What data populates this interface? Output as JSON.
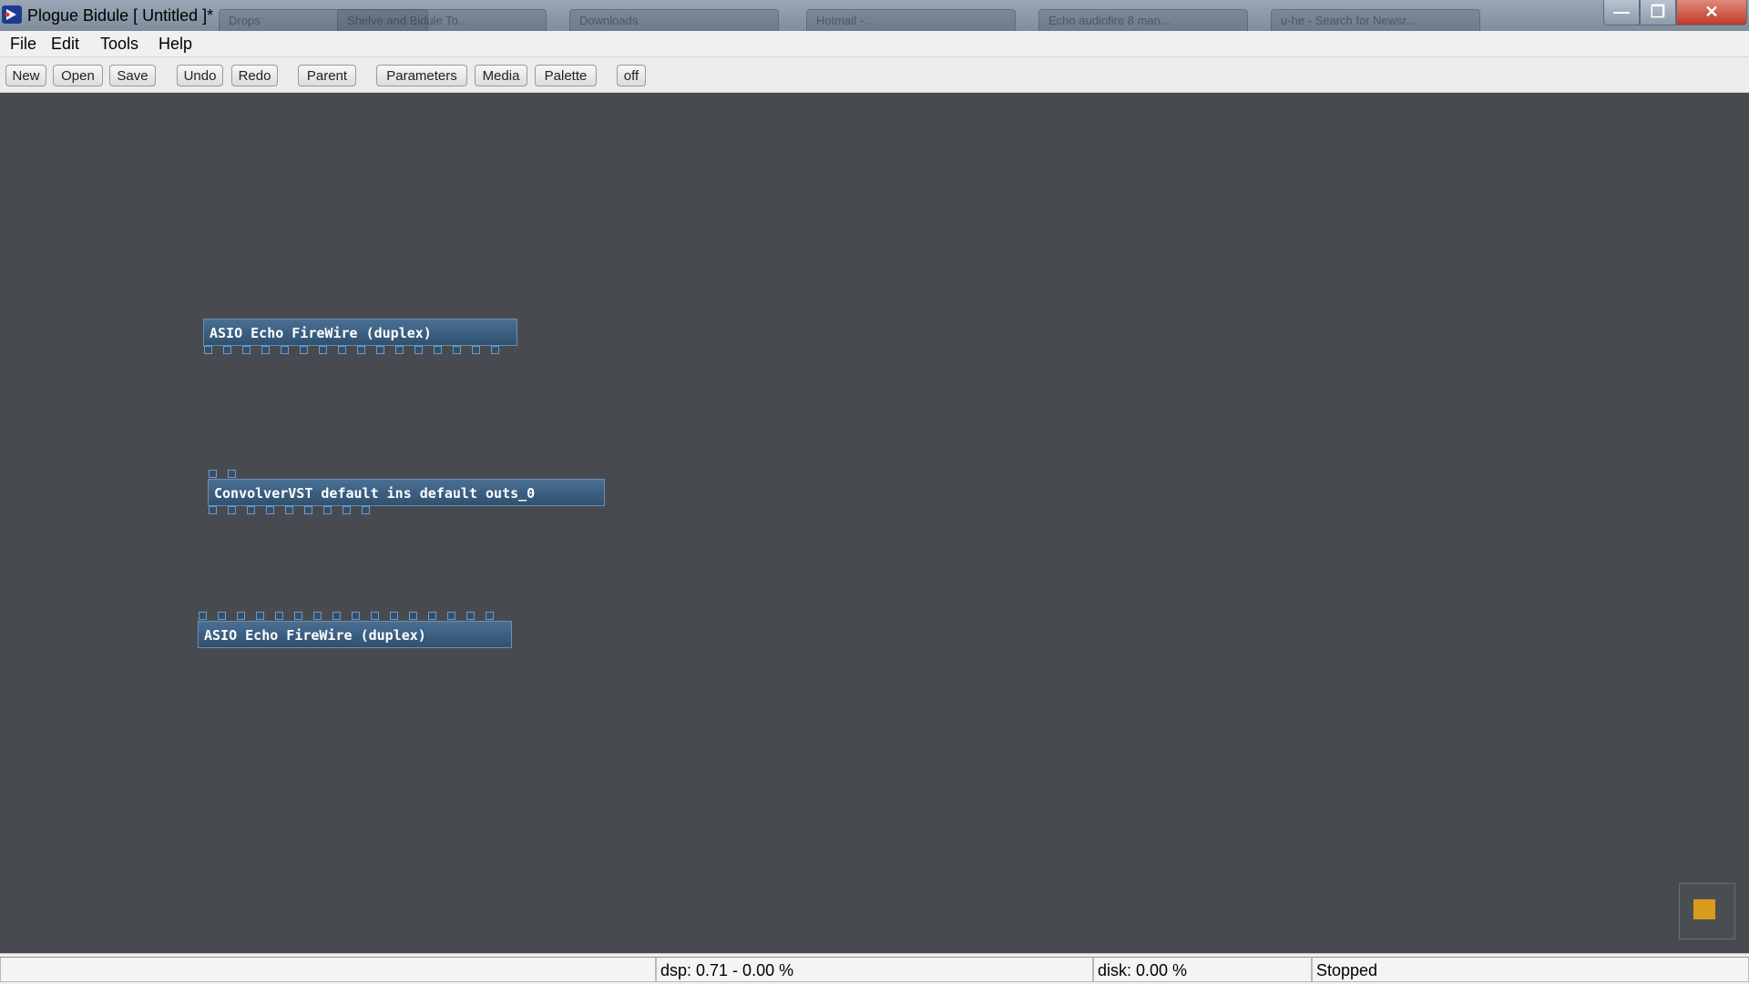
{
  "window": {
    "title": "Plogue Bidule [ Untitled ]*",
    "background_tabs": [
      "Drops",
      "Shelve and Bidule To...",
      "Downloads",
      "Hotmail - ...",
      "Echo audiofire 8 man...",
      "u-he - Search for Newsr..."
    ]
  },
  "menu": {
    "items": [
      "File",
      "Edit",
      "Tools",
      "Help"
    ]
  },
  "toolbar": {
    "new": "New",
    "open": "Open",
    "save": "Save",
    "undo": "Undo",
    "redo": "Redo",
    "parent": "Parent",
    "parameters": "Parameters",
    "media": "Media",
    "palette": "Palette",
    "off": "off"
  },
  "canvas": {
    "nodes": [
      {
        "label": "ASIO Echo FireWire (duplex)",
        "input_pins": 0,
        "output_pins": 16
      },
      {
        "label": "ConvolverVST default ins default outs_0",
        "input_pins": 2,
        "output_pins": 9
      },
      {
        "label": "ASIO Echo FireWire (duplex)",
        "input_pins": 16,
        "output_pins": 0
      }
    ]
  },
  "colors": {
    "canvas": "#474b50",
    "node": "#3a5f82",
    "record": "#d89b1c"
  },
  "statusbar": {
    "dsp": "dsp: 0.71 -  0.00 %",
    "disk": "disk:  0.00 %",
    "state": "Stopped"
  }
}
